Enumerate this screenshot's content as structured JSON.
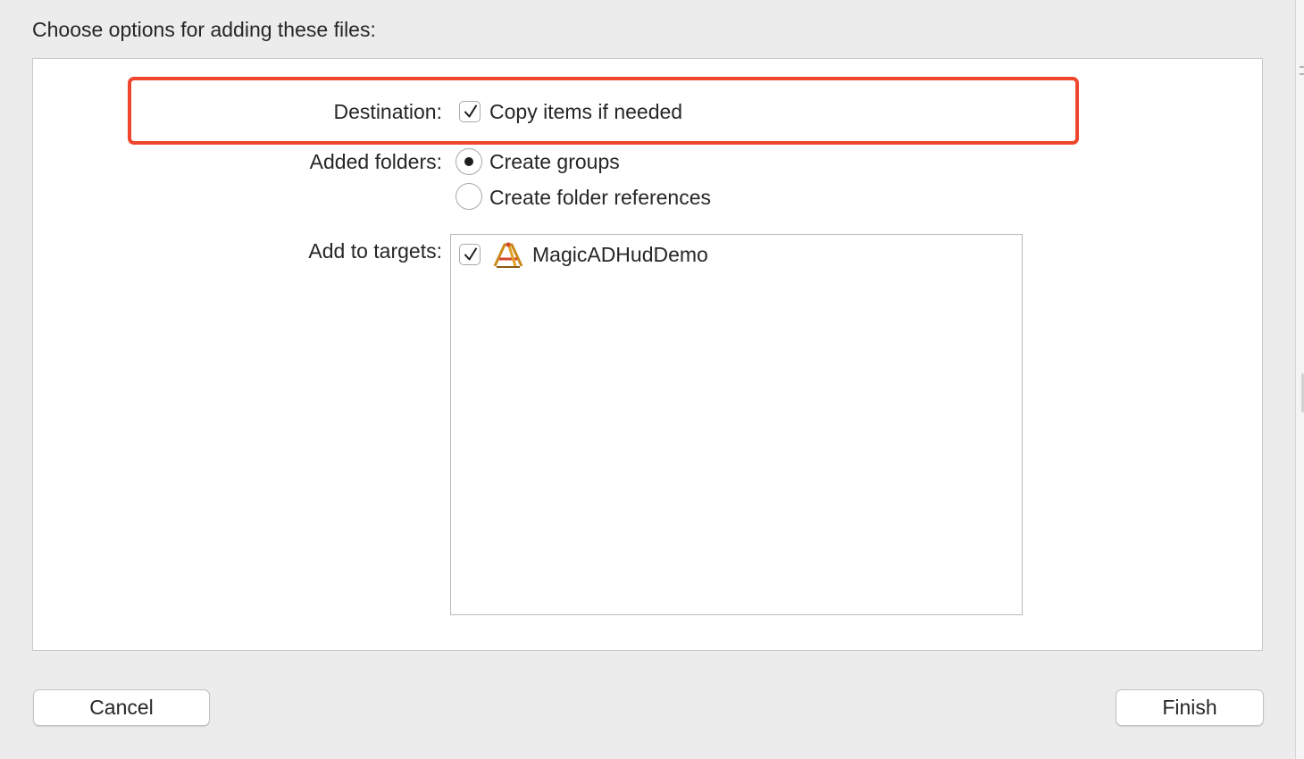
{
  "dialog": {
    "title": "Choose options for adding these files:",
    "destination": {
      "label": "Destination:",
      "option_label": "Copy items if needed",
      "checked": true
    },
    "added_folders": {
      "label": "Added folders:",
      "options": [
        {
          "label": "Create groups",
          "selected": true
        },
        {
          "label": "Create folder references",
          "selected": false
        }
      ]
    },
    "targets": {
      "label": "Add to targets:",
      "items": [
        {
          "name": "MagicADHudDemo",
          "checked": true,
          "icon": "app-target-icon"
        }
      ]
    },
    "buttons": {
      "cancel": "Cancel",
      "finish": "Finish"
    },
    "highlight_color": "#f0462d"
  }
}
